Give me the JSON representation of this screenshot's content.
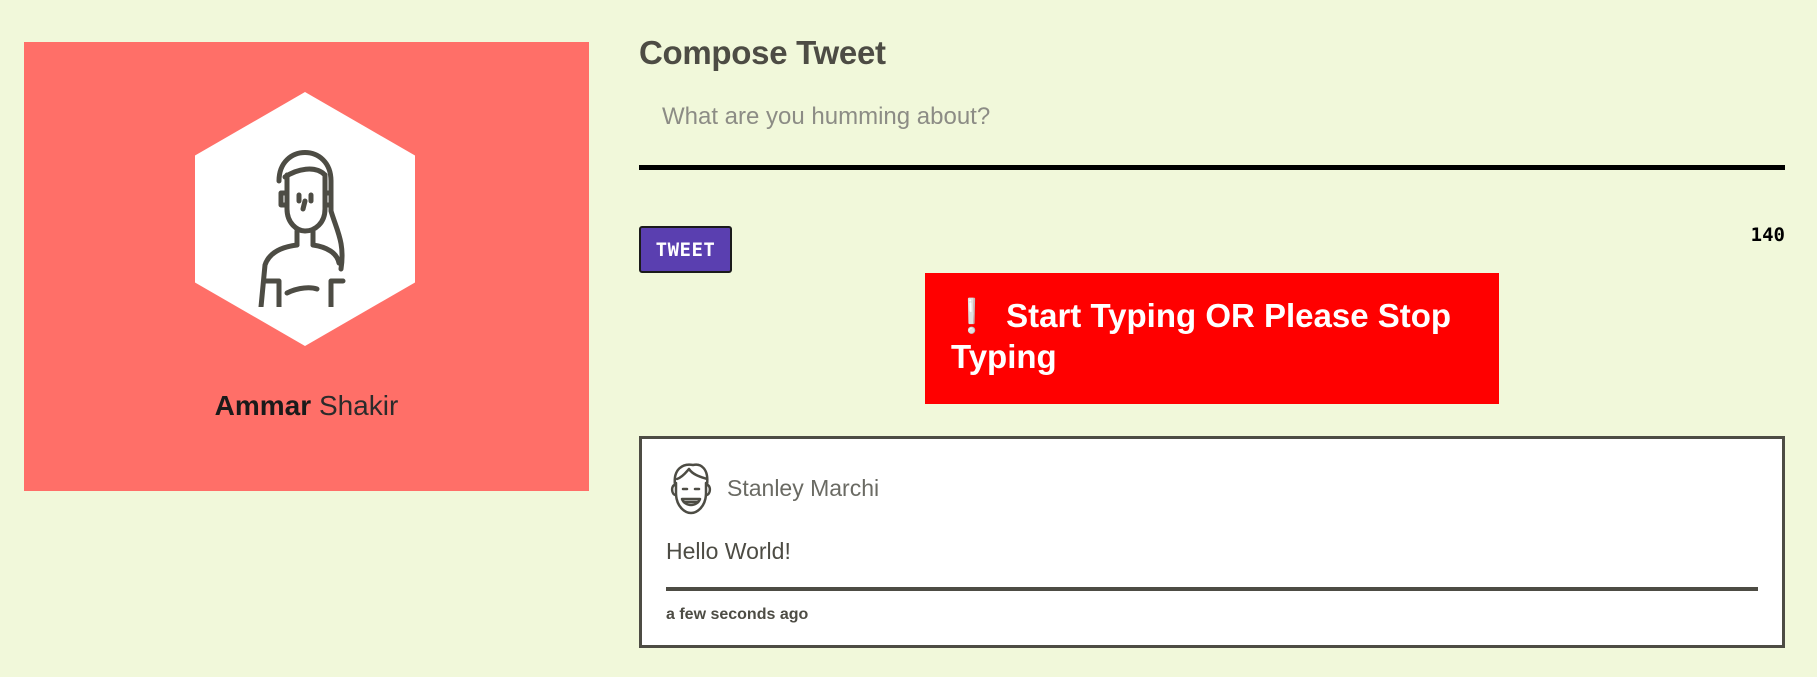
{
  "profile": {
    "first_name": "Ammar",
    "last_name": "Shakir",
    "avatar_icon": "woman-avatar-icon",
    "card_color": "#ff6f68"
  },
  "compose": {
    "title": "Compose Tweet",
    "placeholder": "What are you humming about?",
    "value": "",
    "tweet_button_label": "TWEET",
    "char_count": "140",
    "button_color": "#5a3fb0"
  },
  "alert": {
    "icon": "❕",
    "message": "Start Typing OR Please Stop Typing",
    "color": "#ff0000"
  },
  "tweets": [
    {
      "author": "Stanley Marchi",
      "avatar_icon": "man-avatar-icon",
      "text": "Hello World!",
      "time": "a few seconds ago"
    }
  ],
  "colors": {
    "background": "#f1f8da",
    "text": "#4d4c44"
  }
}
